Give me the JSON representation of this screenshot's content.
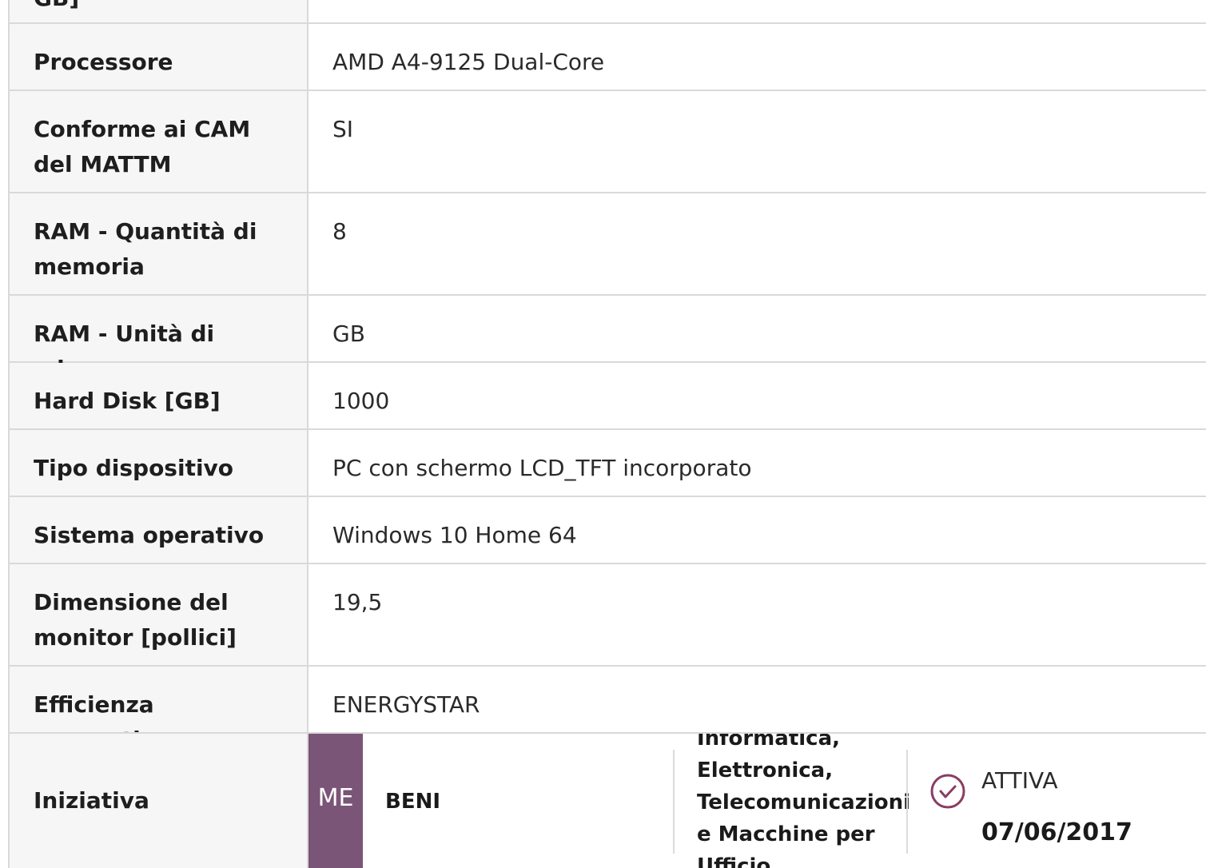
{
  "rows": [
    {
      "label": "GB]",
      "value": ""
    },
    {
      "label": "Processore",
      "value": "AMD A4-9125 Dual-Core"
    },
    {
      "label": "Conforme ai CAM del MATTM",
      "value": "SI"
    },
    {
      "label": "RAM - Quantità di memoria",
      "value": "8"
    },
    {
      "label": "RAM - Unità di misura",
      "value": "GB"
    },
    {
      "label": "Hard Disk [GB]",
      "value": "1000"
    },
    {
      "label": "Tipo dispositivo",
      "value": "PC con schermo LCD_TFT incorporato"
    },
    {
      "label": "Sistema operativo",
      "value": "Windows 10 Home 64"
    },
    {
      "label": "Dimensione del monitor [pollici]",
      "value": "19,5"
    },
    {
      "label": "Efficienza energetica",
      "value": "ENERGYSTAR"
    }
  ],
  "initiative": {
    "label": "Iniziativa",
    "badge": "ME",
    "type": "BENI",
    "category": "Informatica, Elettronica, Telecomunicazioni e Macchine per Ufficio",
    "status": "ATTIVA",
    "date": "07/06/2017",
    "colors": {
      "badge": "#7a5577",
      "status_icon": "#8a3d63"
    },
    "status_icon": "check-circle-icon"
  }
}
